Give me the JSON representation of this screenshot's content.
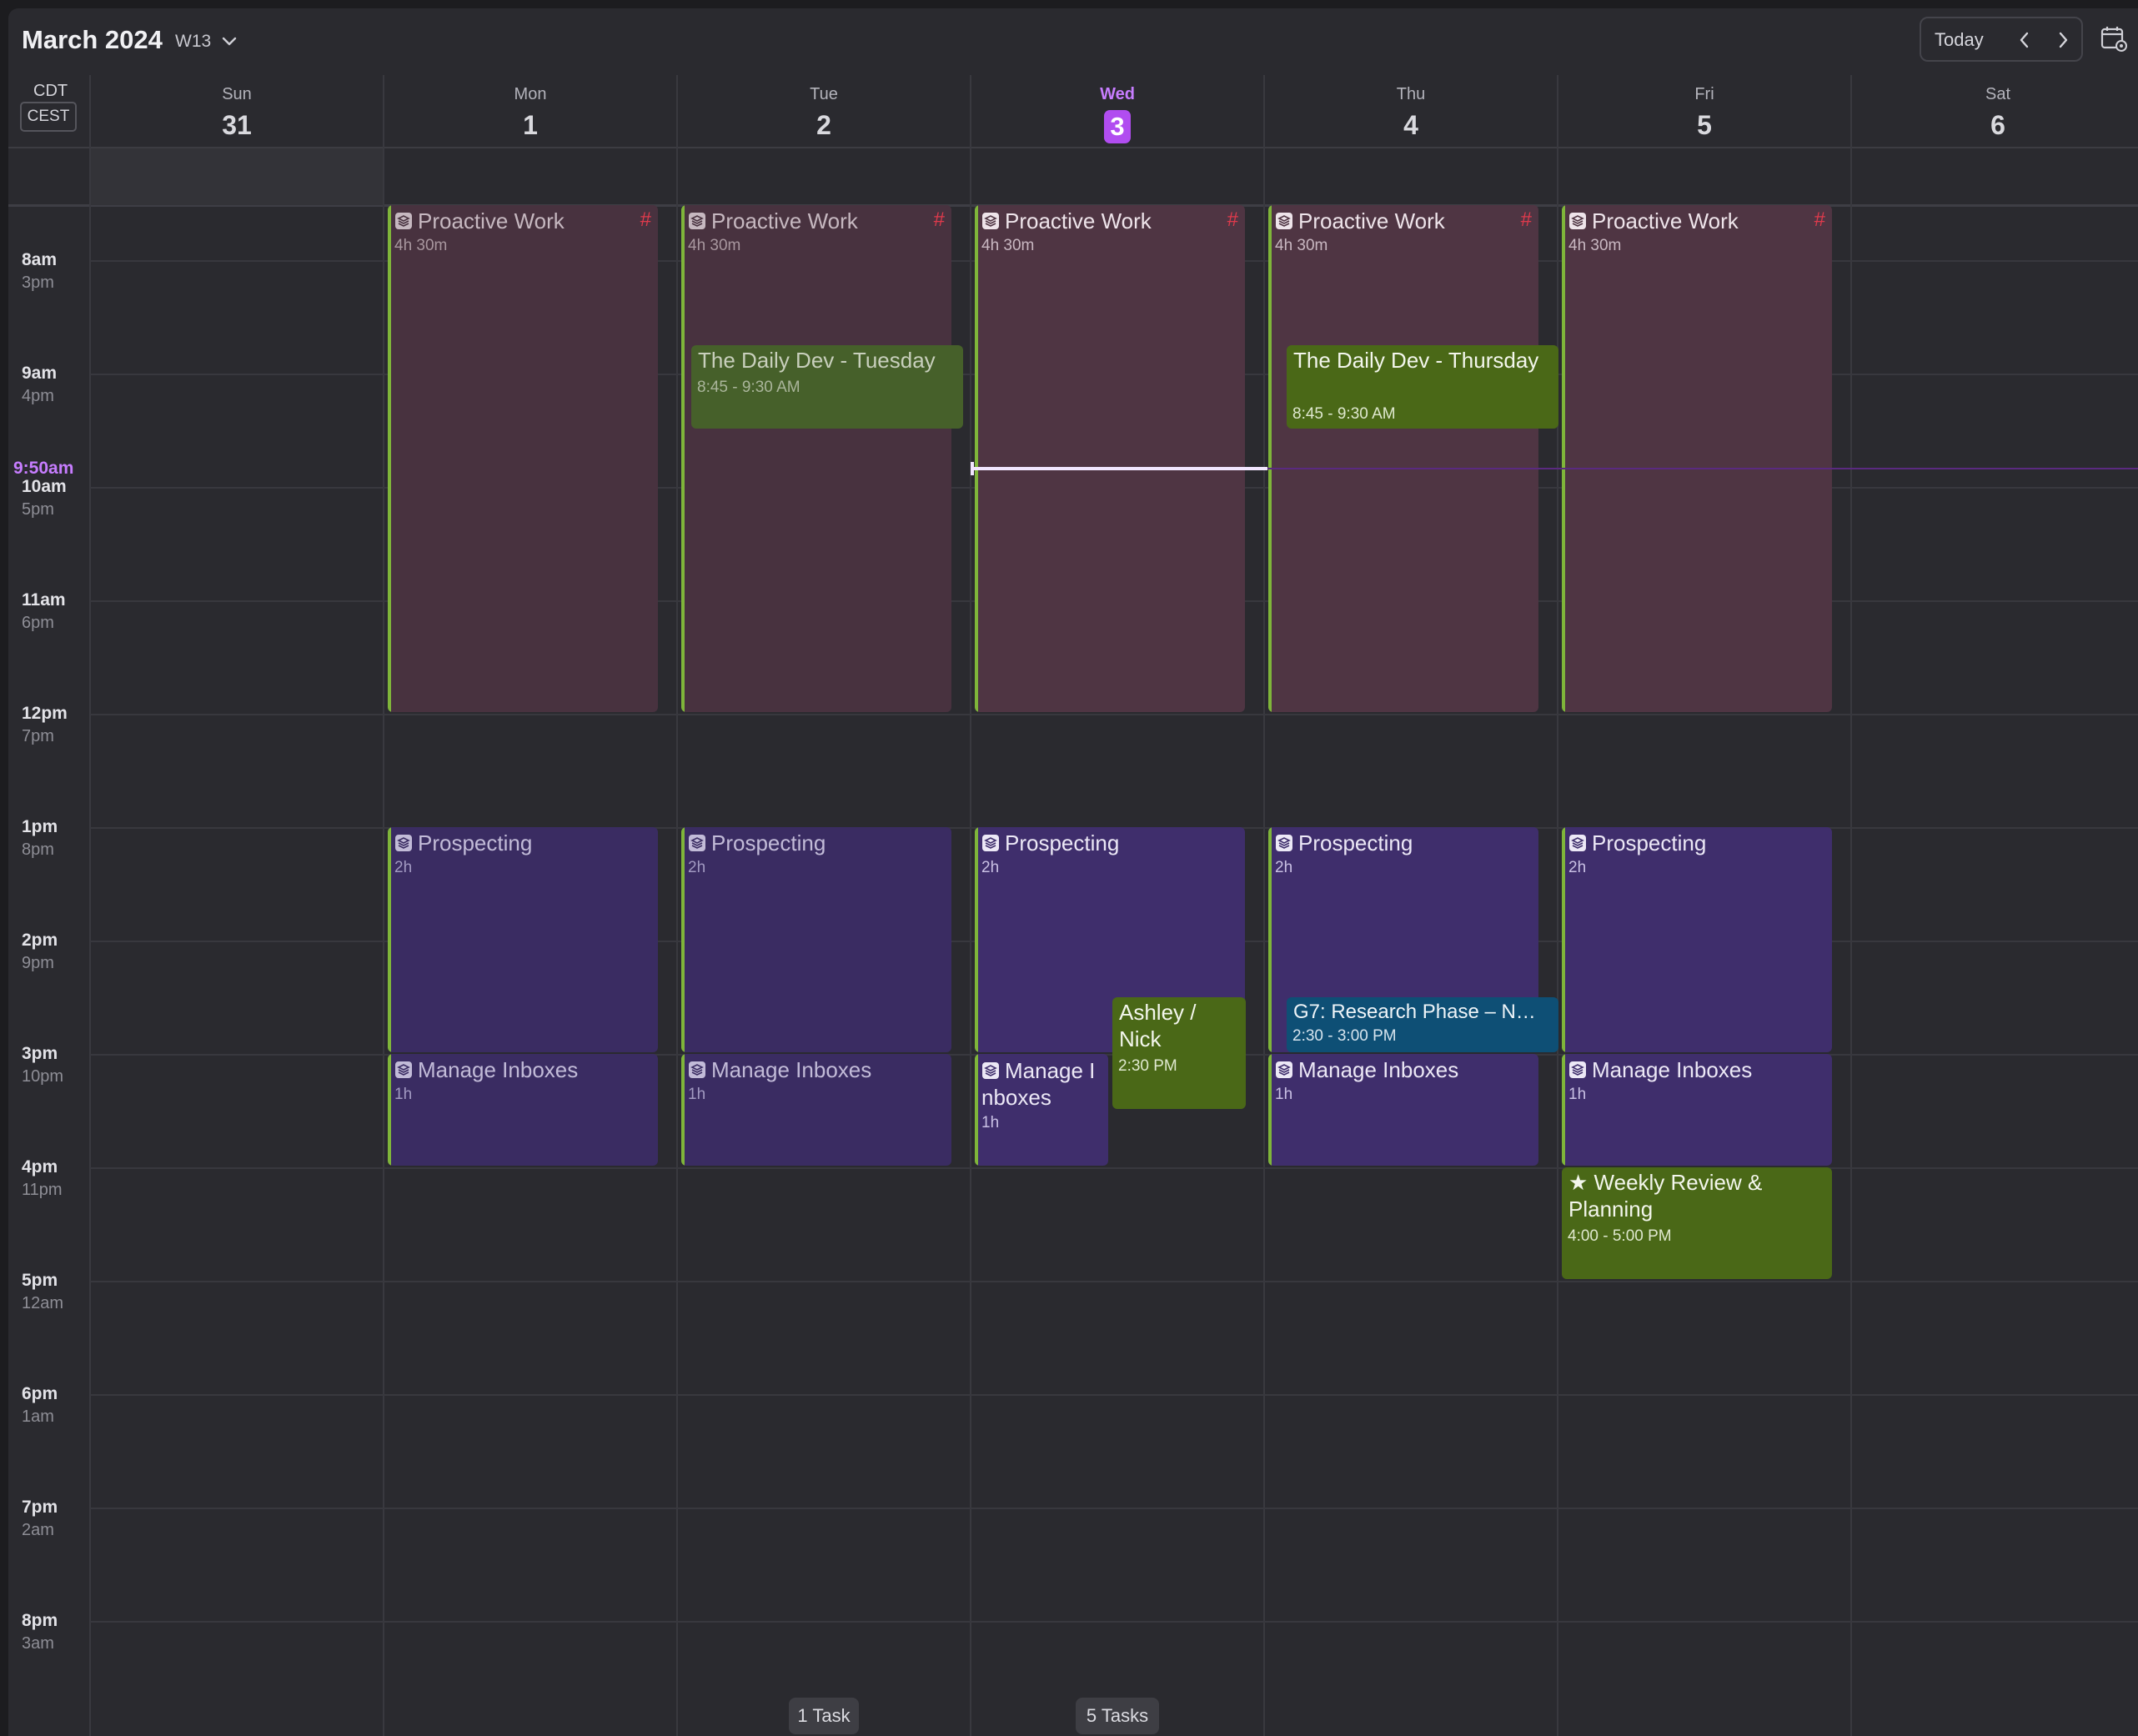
{
  "header": {
    "month_title": "March 2024",
    "week_label": "W13",
    "today_label": "Today"
  },
  "timezones": {
    "primary": "CDT",
    "secondary": "CEST"
  },
  "days": [
    {
      "name": "Sun",
      "num": "31"
    },
    {
      "name": "Mon",
      "num": "1"
    },
    {
      "name": "Tue",
      "num": "2"
    },
    {
      "name": "Wed",
      "num": "3",
      "today": true
    },
    {
      "name": "Thu",
      "num": "4"
    },
    {
      "name": "Fri",
      "num": "5"
    },
    {
      "name": "Sat",
      "num": "6"
    }
  ],
  "hours": [
    {
      "primary": "8am",
      "secondary": "3pm"
    },
    {
      "primary": "9am",
      "secondary": "4pm"
    },
    {
      "primary": "10am",
      "secondary": "5pm"
    },
    {
      "primary": "11am",
      "secondary": "6pm"
    },
    {
      "primary": "12pm",
      "secondary": "7pm"
    },
    {
      "primary": "1pm",
      "secondary": "8pm"
    },
    {
      "primary": "2pm",
      "secondary": "9pm"
    },
    {
      "primary": "3pm",
      "secondary": "10pm"
    },
    {
      "primary": "4pm",
      "secondary": "11pm"
    },
    {
      "primary": "5pm",
      "secondary": "12am"
    },
    {
      "primary": "6pm",
      "secondary": "1am"
    },
    {
      "primary": "7pm",
      "secondary": "2am"
    },
    {
      "primary": "8pm",
      "secondary": "3am"
    }
  ],
  "now_label": "9:50am",
  "events": {
    "proactive_title": "Proactive Work",
    "proactive_dur": "4h 30m",
    "proactive_tag": "#",
    "prospecting_title": "Prospecting",
    "prospecting_dur": "2h",
    "inbox_title": "Manage Inboxes",
    "inbox_title_wrapped": "Manage Inboxes",
    "inbox_dur": "1h",
    "daily_dev_tue_title": "The Daily Dev - Tuesday",
    "daily_dev_tue_time": "8:45 - 9:30 AM",
    "daily_dev_thu_title": "The Daily Dev - Thursday",
    "daily_dev_thu_time": "8:45 - 9:30 AM",
    "ashley_title": "Ashley / Nick",
    "ashley_time": "2:30 PM",
    "g7_title": "G7: Research Phase – N…",
    "g7_time": "2:30 - 3:00 PM",
    "weekly_title": "★ Weekly Review & Planning",
    "weekly_time": "4:00 - 5:00 PM"
  },
  "tasks": {
    "tue": "1 Task",
    "wed": "5 Tasks"
  },
  "colors": {
    "proactive": "#4f3543",
    "prospecting": "#3f2e6c",
    "green_event": "#4a6817",
    "blue_event": "#0e4f75",
    "today_accent": "#b14df0",
    "tag_red": "#e03a4c"
  }
}
